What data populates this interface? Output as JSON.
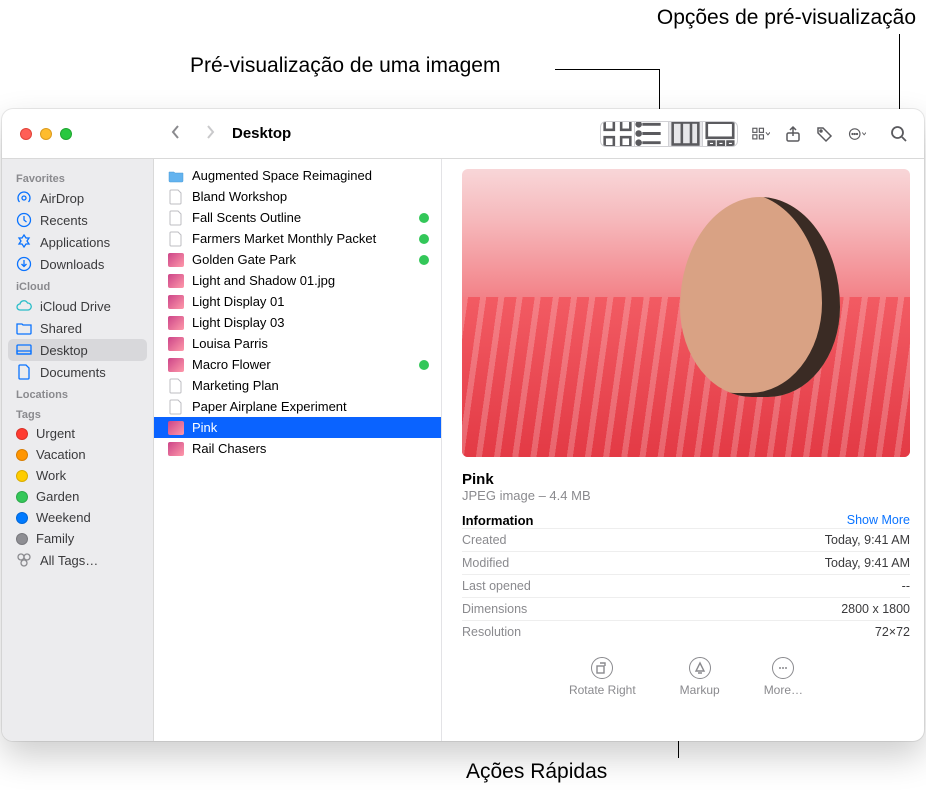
{
  "callouts": {
    "preview_label": "Pré-visualização de uma imagem",
    "options_label": "Opções de pré-visualização",
    "quick_actions_label": "Ações Rápidas"
  },
  "window": {
    "title": "Desktop"
  },
  "sidebar": {
    "favorites": {
      "header": "Favorites",
      "items": [
        "AirDrop",
        "Recents",
        "Applications",
        "Downloads"
      ]
    },
    "icloud": {
      "header": "iCloud",
      "items": [
        "iCloud Drive",
        "Shared",
        "Desktop",
        "Documents"
      ],
      "selected_index": 2
    },
    "locations": {
      "header": "Locations"
    },
    "tags": {
      "header": "Tags",
      "items": [
        {
          "label": "Urgent",
          "color": "#ff3b30"
        },
        {
          "label": "Vacation",
          "color": "#ff9500"
        },
        {
          "label": "Work",
          "color": "#ffcc00"
        },
        {
          "label": "Garden",
          "color": "#34c759"
        },
        {
          "label": "Weekend",
          "color": "#007aff"
        },
        {
          "label": "Family",
          "color": "#8e8e93"
        }
      ],
      "all_tags": "All Tags…"
    }
  },
  "files": [
    {
      "name": "Augmented Space Reimagined",
      "kind": "folder"
    },
    {
      "name": "Bland Workshop",
      "kind": "doc"
    },
    {
      "name": "Fall Scents Outline",
      "kind": "doc",
      "green": true
    },
    {
      "name": "Farmers Market Monthly Packet",
      "kind": "doc",
      "green": true
    },
    {
      "name": "Golden Gate Park",
      "kind": "image",
      "green": true
    },
    {
      "name": "Light and Shadow 01.jpg",
      "kind": "image"
    },
    {
      "name": "Light Display 01",
      "kind": "image"
    },
    {
      "name": "Light Display 03",
      "kind": "image"
    },
    {
      "name": "Louisa Parris",
      "kind": "image"
    },
    {
      "name": "Macro Flower",
      "kind": "image",
      "green": true
    },
    {
      "name": "Marketing Plan",
      "kind": "doc"
    },
    {
      "name": "Paper Airplane Experiment",
      "kind": "doc"
    },
    {
      "name": "Pink",
      "kind": "image",
      "selected": true
    },
    {
      "name": "Rail Chasers",
      "kind": "image"
    }
  ],
  "preview": {
    "title": "Pink",
    "subtitle": "JPEG image – 4.4 MB",
    "info_header": "Information",
    "show_more": "Show More",
    "rows": [
      {
        "k": "Created",
        "v": "Today, 9:41 AM"
      },
      {
        "k": "Modified",
        "v": "Today, 9:41 AM"
      },
      {
        "k": "Last opened",
        "v": "--"
      },
      {
        "k": "Dimensions",
        "v": "2800 x 1800"
      },
      {
        "k": "Resolution",
        "v": "72×72"
      }
    ],
    "quick_actions": [
      "Rotate Right",
      "Markup",
      "More…"
    ]
  }
}
